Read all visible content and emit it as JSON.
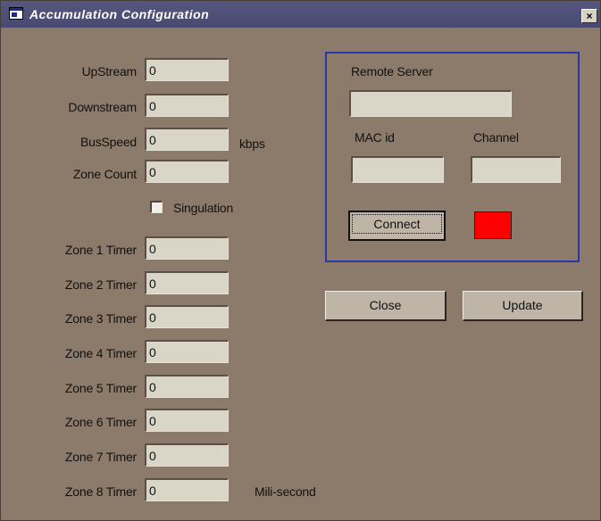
{
  "window": {
    "title": "Accumulation Configuration",
    "close_glyph": "×",
    "icon": "app-window-icon"
  },
  "fields": {
    "upstream": {
      "label": "UpStream",
      "value": "0"
    },
    "downstream": {
      "label": "Downstream",
      "value": "0"
    },
    "busspeed": {
      "label": "BusSpeed",
      "value": "0",
      "unit": "kbps"
    },
    "zone_count": {
      "label": "Zone Count",
      "value": "0"
    }
  },
  "singulation": {
    "label": "Singulation",
    "checked": false
  },
  "zones": [
    {
      "label": "Zone 1 Timer",
      "value": "0"
    },
    {
      "label": "Zone 2 Timer",
      "value": "0"
    },
    {
      "label": "Zone 3 Timer",
      "value": "0"
    },
    {
      "label": "Zone 4 Timer",
      "value": "0"
    },
    {
      "label": "Zone 5 Timer",
      "value": "0"
    },
    {
      "label": "Zone 6 Timer",
      "value": "0"
    },
    {
      "label": "Zone 7 Timer",
      "value": "0"
    },
    {
      "label": "Zone 8 Timer",
      "value": "0"
    }
  ],
  "zone_unit": "Mili-second",
  "remote": {
    "label": "Remote Server",
    "value": "",
    "mac_label": "MAC id",
    "mac_value": "",
    "channel_label": "Channel",
    "channel_value": "",
    "connect_label": "Connect",
    "status_color": "#ff0000"
  },
  "buttons": {
    "close": "Close",
    "update": "Update"
  }
}
